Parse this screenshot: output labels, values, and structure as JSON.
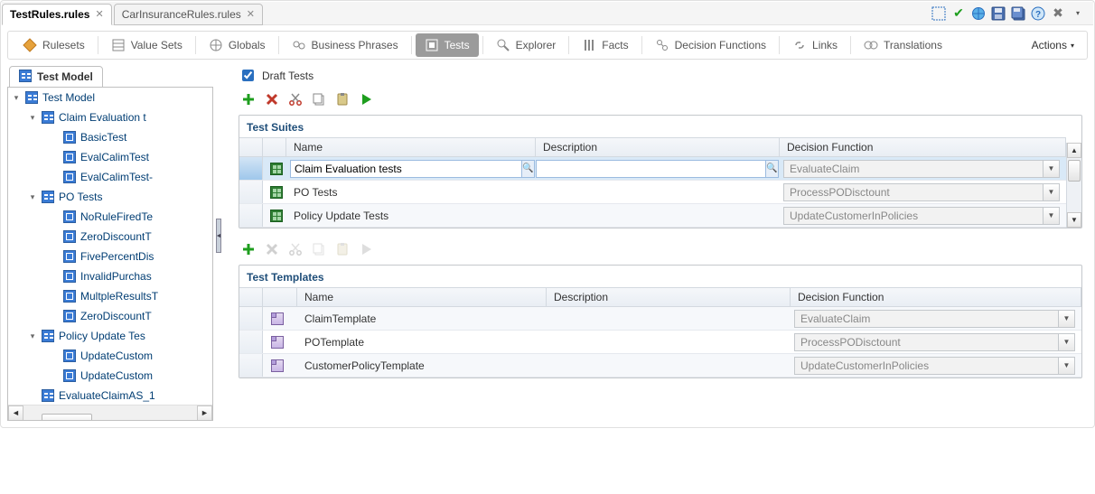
{
  "file_tabs": {
    "active": "TestRules.rules",
    "inactive": "CarInsuranceRules.rules"
  },
  "sub_toolbar": {
    "items": [
      {
        "label": "Rulesets"
      },
      {
        "label": "Value Sets"
      },
      {
        "label": "Globals"
      },
      {
        "label": "Business Phrases"
      },
      {
        "label": "Tests",
        "selected": true
      },
      {
        "label": "Explorer"
      },
      {
        "label": "Facts"
      },
      {
        "label": "Decision Functions"
      },
      {
        "label": "Links"
      },
      {
        "label": "Translations"
      }
    ],
    "actions": "Actions"
  },
  "tree": {
    "header": "Test Model",
    "nodes": [
      {
        "depth": 0,
        "expand": true,
        "icon": "tm",
        "label": "Test Model"
      },
      {
        "depth": 1,
        "expand": true,
        "icon": "tm",
        "label": "Claim Evaluation t"
      },
      {
        "depth": 2,
        "icon": "df",
        "label": "BasicTest"
      },
      {
        "depth": 2,
        "icon": "df",
        "label": "EvalCalimTest"
      },
      {
        "depth": 2,
        "icon": "df",
        "label": "EvalCalimTest-"
      },
      {
        "depth": 1,
        "expand": true,
        "icon": "tm",
        "label": "PO Tests"
      },
      {
        "depth": 2,
        "icon": "df",
        "label": "NoRuleFiredTe"
      },
      {
        "depth": 2,
        "icon": "df",
        "label": "ZeroDiscountT"
      },
      {
        "depth": 2,
        "icon": "df",
        "label": "FivePercentDis"
      },
      {
        "depth": 2,
        "icon": "df",
        "label": "InvalidPurchas"
      },
      {
        "depth": 2,
        "icon": "df",
        "label": "MultpleResultsT"
      },
      {
        "depth": 2,
        "icon": "df",
        "label": "ZeroDiscountT"
      },
      {
        "depth": 1,
        "expand": true,
        "icon": "tm",
        "label": "Policy Update Tes"
      },
      {
        "depth": 2,
        "icon": "df",
        "label": "UpdateCustom"
      },
      {
        "depth": 2,
        "icon": "df",
        "label": "UpdateCustom"
      },
      {
        "depth": 1,
        "icon": "tm",
        "label": "EvaluateClaimAS_1"
      }
    ]
  },
  "draft": {
    "label": "Draft Tests",
    "checked": true
  },
  "suites": {
    "title": "Test Suites",
    "columns": {
      "name": "Name",
      "desc": "Description",
      "df": "Decision Function"
    },
    "rows": [
      {
        "name": "Claim Evaluation tests",
        "desc": "",
        "df": "EvaluateClaim",
        "selected": true,
        "editable": true
      },
      {
        "name": "PO Tests",
        "desc": "",
        "df": "ProcessPODisctount"
      },
      {
        "name": "Policy Update Tests",
        "desc": "",
        "df": "UpdateCustomerInPolicies"
      }
    ]
  },
  "templates": {
    "title": "Test Templates",
    "columns": {
      "name": "Name",
      "desc": "Description",
      "df": "Decision Function"
    },
    "rows": [
      {
        "name": "ClaimTemplate",
        "desc": "",
        "df": "EvaluateClaim"
      },
      {
        "name": "POTemplate",
        "desc": "",
        "df": "ProcessPODisctount"
      },
      {
        "name": "CustomerPolicyTemplate",
        "desc": "",
        "df": "UpdateCustomerInPolicies"
      }
    ]
  }
}
